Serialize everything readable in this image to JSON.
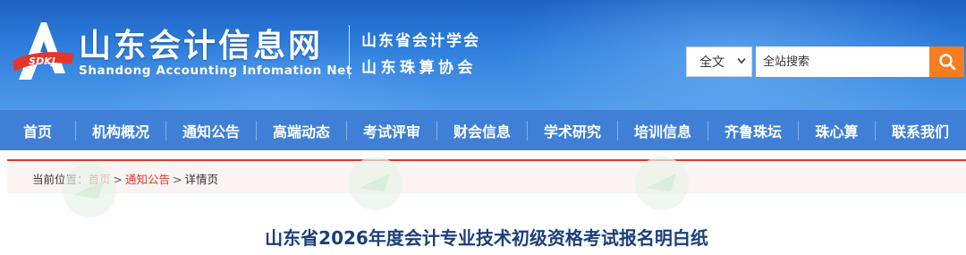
{
  "header": {
    "logo_letters": "SDKJ",
    "site_title": "山东会计信息网",
    "site_subtitle": "Shandong Accounting Infomation Net",
    "associations": [
      "山东省会计学会",
      "山东珠算协会"
    ]
  },
  "search": {
    "scope_selected": "全文",
    "input_value": "",
    "placeholder": "全站搜索",
    "button_icon": "search-icon"
  },
  "nav": {
    "items": [
      "首页",
      "机构概况",
      "通知公告",
      "高端动态",
      "考试评审",
      "财会信息",
      "学术研究",
      "培训信息",
      "齐鲁珠坛",
      "珠心算",
      "联系我们"
    ]
  },
  "breadcrumb": {
    "prefix": "当前位置：",
    "links": [
      "首页",
      "通知公告"
    ],
    "current": "详情页",
    "separator": ">"
  },
  "article": {
    "title": "山东省2026年度会计专业技术初级资格考试报名明白纸"
  },
  "colors": {
    "header_blue": "#2f7fdd",
    "nav_blue": "#3f80d6",
    "search_orange": "#f57d20",
    "breadcrumb_red": "#d43c2f",
    "title_navy": "#1b3f7a"
  }
}
